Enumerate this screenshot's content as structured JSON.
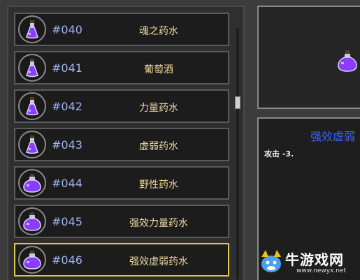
{
  "potion_list": {
    "items": [
      {
        "number": "#040",
        "name": "魂之药水",
        "icon": "small-purple-flask-icon"
      },
      {
        "number": "#041",
        "name": "葡萄酒",
        "icon": "small-purple-flask-icon"
      },
      {
        "number": "#042",
        "name": "力量药水",
        "icon": "small-purple-flask-icon"
      },
      {
        "number": "#043",
        "name": "虚弱药水",
        "icon": "small-purple-flask-icon"
      },
      {
        "number": "#044",
        "name": "野性药水",
        "icon": "large-purple-flask-icon"
      },
      {
        "number": "#045",
        "name": "强效力量药水",
        "icon": "large-purple-flask-icon"
      },
      {
        "number": "#046",
        "name": "强效虚弱药水",
        "icon": "large-purple-flask-icon",
        "selected": true
      }
    ]
  },
  "detail": {
    "title": "强效虚弱",
    "effect": "攻击 -3."
  },
  "watermark": {
    "text": "牛游戏网",
    "url": "www.newyx.net"
  },
  "colors": {
    "number": "#9fb4f2",
    "name": "#eed79c",
    "selected_border": "#d8c84a",
    "title": "#3f5fff",
    "potion": "#8a3cff"
  }
}
